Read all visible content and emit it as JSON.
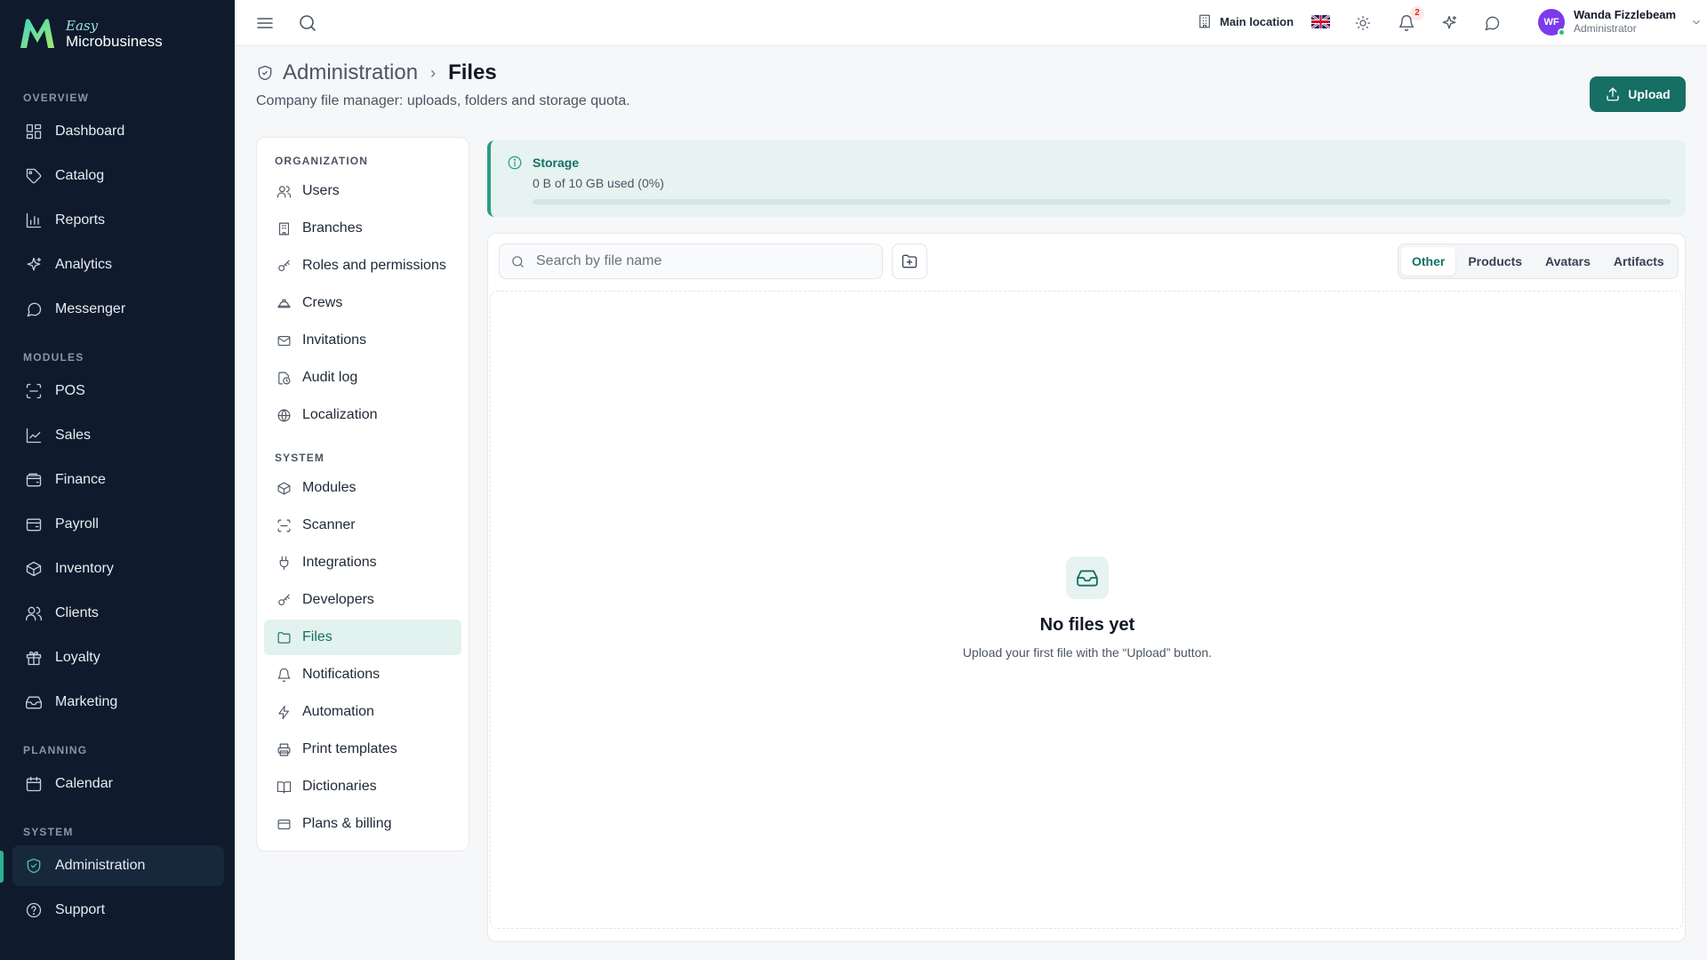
{
  "brand": {
    "easy": "Easy",
    "name": "Microbusiness"
  },
  "sidebar": {
    "sections": [
      {
        "label": "OVERVIEW"
      },
      {
        "label": "MODULES"
      },
      {
        "label": "PLANNING"
      },
      {
        "label": "SYSTEM"
      }
    ],
    "items": [
      {
        "label": "Dashboard"
      },
      {
        "label": "Catalog"
      },
      {
        "label": "Reports"
      },
      {
        "label": "Analytics"
      },
      {
        "label": "Messenger"
      },
      {
        "label": "POS"
      },
      {
        "label": "Sales"
      },
      {
        "label": "Finance"
      },
      {
        "label": "Payroll"
      },
      {
        "label": "Inventory"
      },
      {
        "label": "Clients"
      },
      {
        "label": "Loyalty"
      },
      {
        "label": "Marketing"
      },
      {
        "label": "Calendar"
      },
      {
        "label": "Administration"
      },
      {
        "label": "Support"
      }
    ],
    "active": "Administration"
  },
  "topbar": {
    "location": "Main location",
    "notifications_count": "2",
    "user": {
      "initials": "WF",
      "name": "Wanda Fizzlebeam",
      "role": "Administrator"
    }
  },
  "page": {
    "breadcrumb_parent": "Administration",
    "breadcrumb_separator": "›",
    "title": "Files",
    "subtitle": "Company file manager: uploads, folders and storage quota.",
    "upload_label": "Upload"
  },
  "subnav": {
    "sections": [
      {
        "label": "ORGANIZATION"
      },
      {
        "label": "SYSTEM"
      }
    ],
    "items": [
      {
        "label": "Users"
      },
      {
        "label": "Branches"
      },
      {
        "label": "Roles and permissions"
      },
      {
        "label": "Crews"
      },
      {
        "label": "Invitations"
      },
      {
        "label": "Audit log"
      },
      {
        "label": "Localization"
      },
      {
        "label": "Modules"
      },
      {
        "label": "Scanner"
      },
      {
        "label": "Integrations"
      },
      {
        "label": "Developers"
      },
      {
        "label": "Files"
      },
      {
        "label": "Notifications"
      },
      {
        "label": "Automation"
      },
      {
        "label": "Print templates"
      },
      {
        "label": "Dictionaries"
      },
      {
        "label": "Plans & billing"
      }
    ],
    "active": "Files"
  },
  "storage": {
    "title": "Storage",
    "used_text": "0 B of 10 GB used (0%)",
    "used_fraction": 0
  },
  "files": {
    "search_placeholder": "Search by file name",
    "tabs": [
      {
        "label": "Other"
      },
      {
        "label": "Products"
      },
      {
        "label": "Avatars"
      },
      {
        "label": "Artifacts"
      }
    ],
    "active_tab": "Other",
    "empty_title": "No files yet",
    "empty_text": "Upload your first file with the “Upload” button."
  },
  "colors": {
    "sidebar_bg": "#0f1b2d",
    "accent": "#166e64",
    "accent_light": "#e6f3f1"
  }
}
